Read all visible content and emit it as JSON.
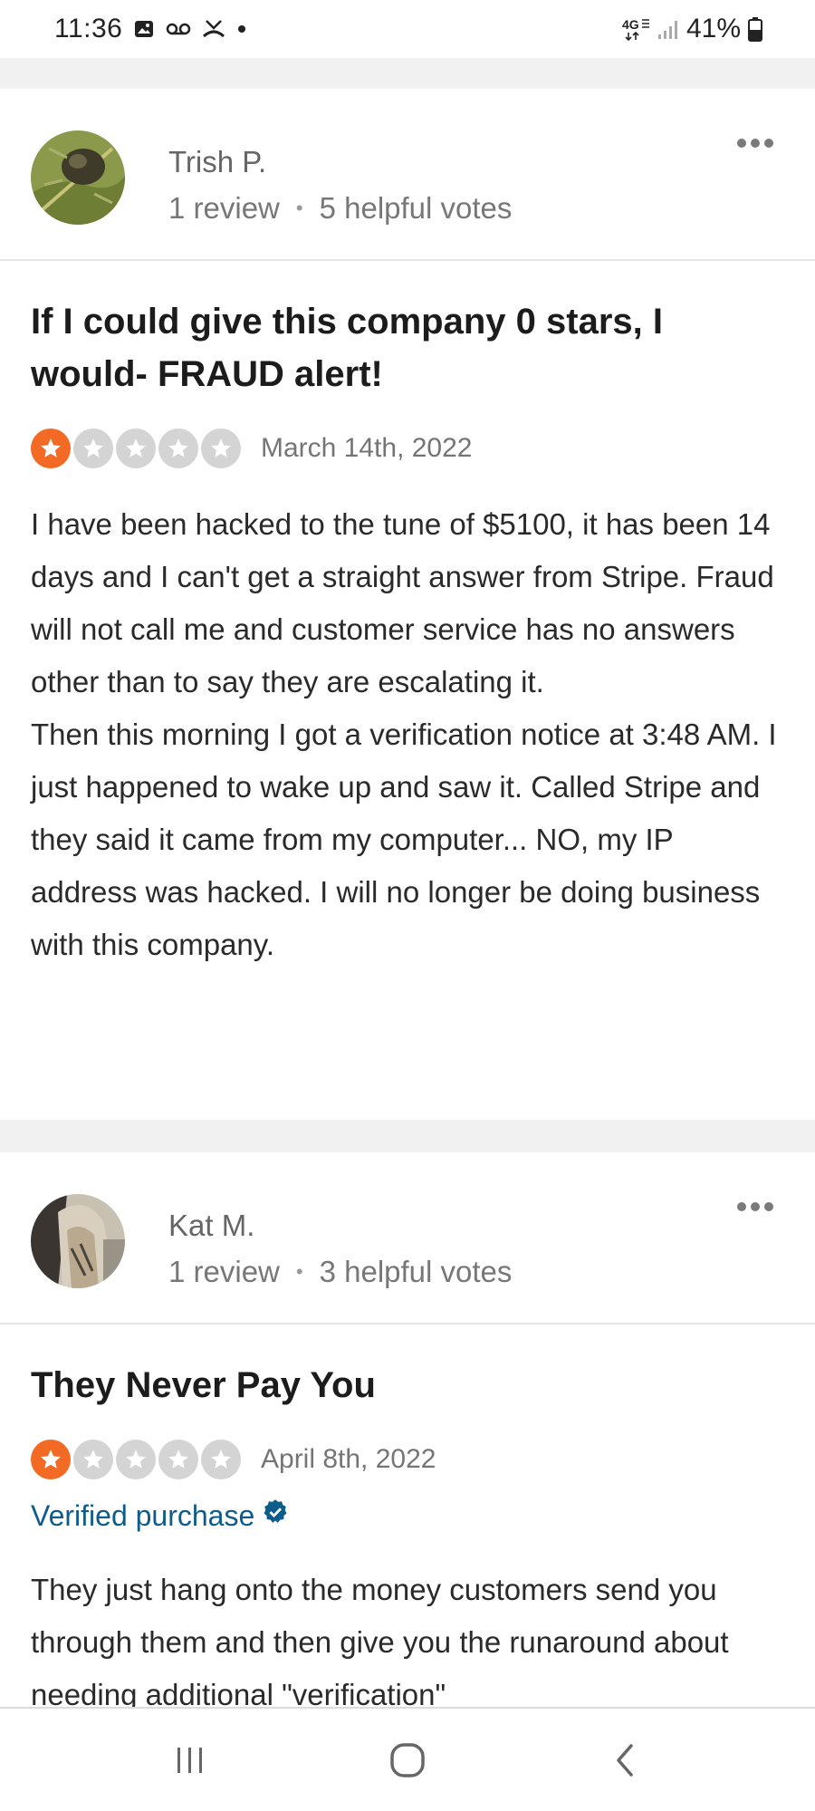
{
  "status_bar": {
    "time": "11:36",
    "network": "4G",
    "battery": "41%",
    "icons": [
      "gallery-icon",
      "voicemail-icon",
      "missed-call-icon",
      "notification-dot-icon",
      "4g-icon",
      "signal-icon",
      "battery-icon"
    ]
  },
  "reviews": [
    {
      "reviewer_name": "Trish P.",
      "review_count": "1 review",
      "helpful_votes": "5 helpful votes",
      "title": "If I could give this company 0 stars, I would- FRAUD alert!",
      "rating": 1,
      "max_rating": 5,
      "date": "March 14th, 2022",
      "body": "I have been hacked to the tune of $5100, it has been 14 days and I can't get a straight answer from Stripe. Fraud will not call me and customer service has no answers other than to say they are escalating it.\nThen this morning I got a verification notice at 3:48 AM. I just happened to wake up and saw it. Called Stripe and they said it came from my computer... NO, my IP address was hacked. I will no longer be doing business with this company."
    },
    {
      "reviewer_name": "Kat M.",
      "review_count": "1 review",
      "helpful_votes": "3 helpful votes",
      "title": "They Never Pay You",
      "rating": 1,
      "max_rating": 5,
      "date": "April 8th, 2022",
      "verified_label": "Verified purchase",
      "body": "They just hang onto the money customers send you through them and then give you the runaround about needing additional \"verification\""
    }
  ],
  "colors": {
    "star_filled": "#f26a24",
    "star_empty": "#d4d4d4",
    "verified": "#0e5c8c",
    "separator": "#f1f1f1"
  },
  "nav": {
    "icons": [
      "recent-apps-icon",
      "home-icon",
      "back-icon"
    ]
  }
}
